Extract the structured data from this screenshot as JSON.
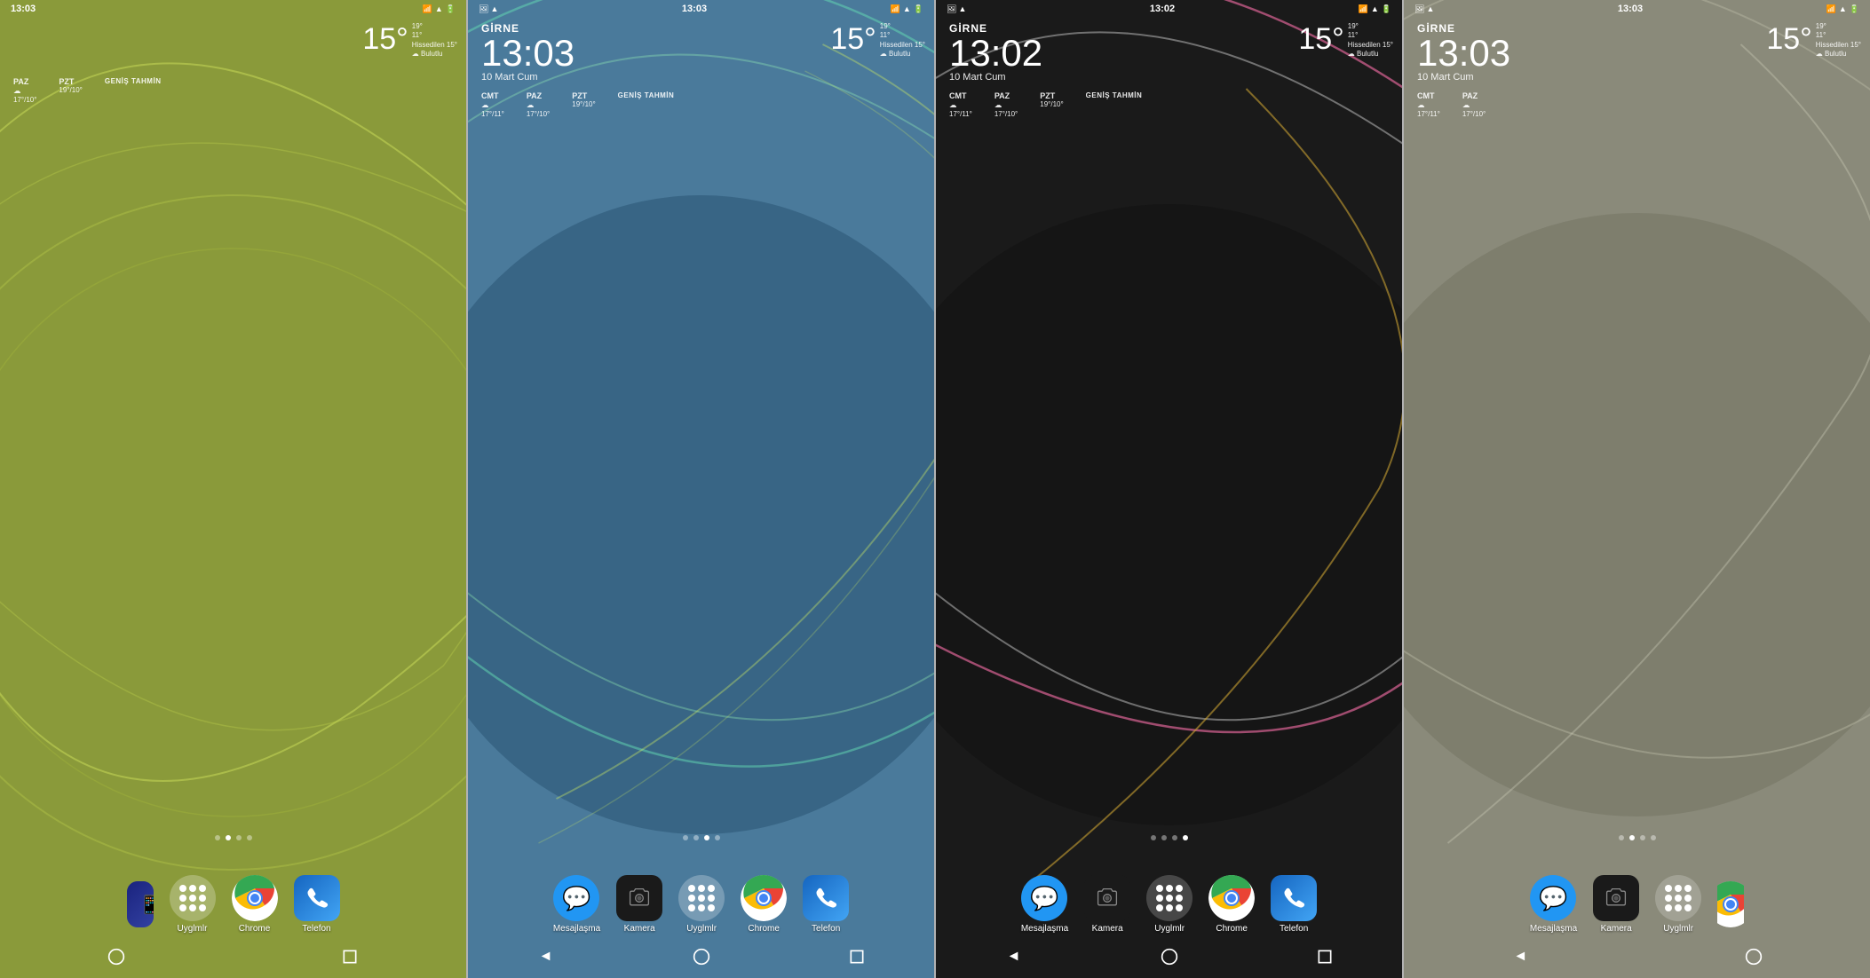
{
  "screens": [
    {
      "id": "screen-1",
      "bg_color": "#8a9a3a",
      "status_time": "13:03",
      "city": "",
      "clock": "",
      "date": "",
      "temp_big": "15°",
      "temp_high": "19°",
      "temp_low": "11°",
      "feels": "Hissedilen 15°",
      "condition": "Bulutlu",
      "forecasts": [
        {
          "day": "PAZ",
          "icon": "☁",
          "temps": "17°/10°"
        },
        {
          "day": "PZT",
          "icon": "",
          "temps": "19°/10°",
          "label": "GENİŞ TAHMİN"
        }
      ],
      "dots": [
        false,
        true,
        false,
        false
      ],
      "dock": [
        "kamera-partial",
        "uygulama",
        "chrome",
        "telefon"
      ],
      "nav": [
        "circle",
        "square",
        "triangle"
      ]
    },
    {
      "id": "screen-2",
      "bg_color": "#4a7a9b",
      "status_time": "13:03",
      "city": "GİRNE",
      "clock": "13:03",
      "date": "10 Mart Cum",
      "temp_big": "15°",
      "temp_high": "19°",
      "temp_low": "11°",
      "feels": "Hissedilen 15°",
      "condition": "Bulutlu",
      "forecasts": [
        {
          "day": "CMT",
          "icon": "☁",
          "temps": "17°/11°"
        },
        {
          "day": "PAZ",
          "icon": "☁",
          "temps": "17°/10°"
        },
        {
          "day": "PZT",
          "icon": "",
          "temps": "19°/10°",
          "label": "GENİŞ TAHMİN"
        }
      ],
      "dots": [
        false,
        false,
        true,
        false
      ],
      "dock": [
        "mesajlasma",
        "kamera",
        "uygulama",
        "chrome",
        "telefon"
      ],
      "nav": [
        "triangle",
        "circle",
        "square"
      ]
    },
    {
      "id": "screen-3",
      "bg_color": "#1a1a1a",
      "status_time": "13:02",
      "city": "GİRNE",
      "clock": "13:02",
      "date": "10 Mart Cum",
      "temp_big": "15°",
      "temp_high": "19°",
      "temp_low": "11°",
      "feels": "Hissedilen 15°",
      "condition": "Bulutlu",
      "forecasts": [
        {
          "day": "CMT",
          "icon": "☁",
          "temps": "17°/11°"
        },
        {
          "day": "PAZ",
          "icon": "☁",
          "temps": "17°/10°"
        },
        {
          "day": "PZT",
          "icon": "",
          "temps": "19°/10°",
          "label": "GENİŞ TAHMİN"
        }
      ],
      "dots": [
        false,
        false,
        false,
        true
      ],
      "dock": [
        "mesajlasma",
        "kamera",
        "uygulama",
        "chrome",
        "telefon"
      ],
      "nav": [
        "triangle",
        "circle",
        "square"
      ]
    },
    {
      "id": "screen-4",
      "bg_color": "#8a8a7a",
      "status_time": "13:03",
      "city": "GİRNE",
      "clock": "13:03",
      "date": "10 Mart Cum",
      "temp_big": "15°",
      "temp_high": "19°",
      "temp_low": "11°",
      "feels": "Hissedilen 15°",
      "condition": "Bulutlu",
      "forecasts": [
        {
          "day": "CMT",
          "icon": "☁",
          "temps": "17°/11°"
        },
        {
          "day": "PAZ",
          "icon": "☁",
          "temps": "17°/10°"
        }
      ],
      "dots": [
        false,
        true,
        false,
        false
      ],
      "dock": [
        "mesajlasma",
        "kamera",
        "uygulama",
        "chrome-partial"
      ],
      "nav": [
        "triangle",
        "circle"
      ]
    }
  ],
  "app_labels": {
    "mesajlasma": "Mesajlaşma",
    "kamera": "Kamera",
    "uygulama": "Uyglmlr",
    "chrome": "Chrome",
    "telefon": "Telefon"
  },
  "nav_icons": {
    "back": "◄",
    "home": "○",
    "recents": "■"
  }
}
